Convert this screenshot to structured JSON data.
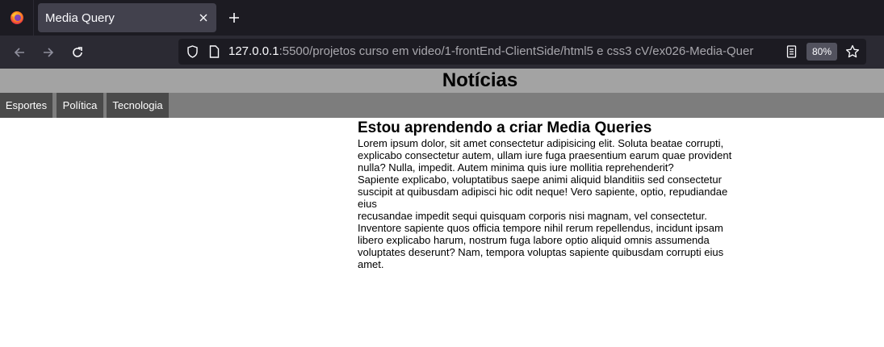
{
  "browser": {
    "tab_title": "Media Query",
    "url_host": "127.0.0.1",
    "url_rest": ":5500/projetos curso em video/1-frontEnd-ClientSide/html5 e css3 cV/ex026-Media-Quer",
    "zoom": "80%",
    "icons": {
      "firefox": "firefox-logo-icon",
      "close": "close-icon",
      "new_tab": "plus-icon",
      "back": "arrow-left-icon",
      "forward": "arrow-right-icon",
      "reload": "reload-icon",
      "shield": "shield-icon",
      "page": "page-icon",
      "reader": "reader-view-icon",
      "star": "star-icon"
    }
  },
  "page": {
    "title": "Notícias",
    "menu": [
      "Esportes",
      "Política",
      "Tecnologia"
    ],
    "article": {
      "heading": "Estou aprendendo a criar Media Queries",
      "lines": [
        "Lorem ipsum dolor, sit amet consectetur adipisicing elit. Soluta beatae corrupti,",
        "explicabo consectetur autem, ullam iure fuga praesentium earum quae provident",
        "nulla? Nulla, impedit. Autem minima quis iure mollitia reprehenderit?",
        "Sapiente explicabo, voluptatibus saepe animi aliquid blanditiis sed consectetur",
        "suscipit at quibusdam adipisci hic odit neque! Vero sapiente, optio, repudiandae eius",
        "recusandae impedit sequi quisquam corporis nisi magnam, vel consectetur.",
        "Inventore sapiente quos officia tempore nihil rerum repellendus, incidunt ipsam",
        "libero explicabo harum, nostrum fuga labore optio aliquid omnis assumenda",
        "voluptates deserunt? Nam, tempora voluptas sapiente quibusdam corrupti eius",
        "amet."
      ]
    }
  },
  "colors": {
    "tabbar": "#1c1b22",
    "header": "#a3a3a3",
    "nav": "#7d7d7d",
    "menu_item": "#4a4a4a"
  }
}
